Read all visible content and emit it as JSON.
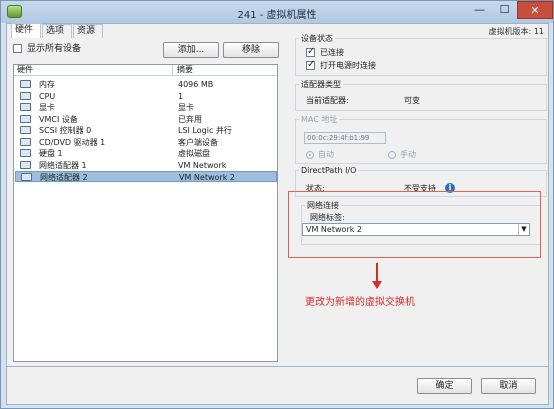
{
  "window": {
    "title": "241 - 虚拟机属性",
    "minimize_label": "—",
    "maximize_label": "☐",
    "close_label": "✕"
  },
  "tabs": [
    {
      "label": "硬件",
      "active": true
    },
    {
      "label": "选项",
      "active": false
    },
    {
      "label": "资源",
      "active": false
    }
  ],
  "version_text": "虚拟机版本: 11",
  "left_panel": {
    "show_all_label": "显示所有设备",
    "show_all_checked": false,
    "add_button": "添加...",
    "remove_button": "移除",
    "col_hardware": "硬件",
    "col_summary": "摘要",
    "devices": [
      {
        "icon": "memory-icon",
        "name": "内存",
        "summary": "4096 MB",
        "selected": false
      },
      {
        "icon": "cpu-icon",
        "name": "CPU",
        "summary": "1",
        "selected": false
      },
      {
        "icon": "display-icon",
        "name": "显卡",
        "summary": "显卡",
        "selected": false
      },
      {
        "icon": "vmci-icon",
        "name": "VMCI 设备",
        "summary": "已弃用",
        "selected": false
      },
      {
        "icon": "scsi-icon",
        "name": "SCSI 控制器 0",
        "summary": "LSI Logic 并行",
        "selected": false
      },
      {
        "icon": "cd-dvd-icon",
        "name": "CD/DVD 驱动器 1",
        "summary": "客户端设备",
        "selected": false
      },
      {
        "icon": "disk-icon",
        "name": "硬盘 1",
        "summary": "虚拟磁盘",
        "selected": false
      },
      {
        "icon": "network-icon",
        "name": "网络适配器 1",
        "summary": "VM Network",
        "selected": false
      },
      {
        "icon": "network-icon",
        "name": "网络适配器 2",
        "summary": "VM Network 2",
        "selected": true
      }
    ]
  },
  "device_status": {
    "title": "设备状态",
    "connected_label": "已连接",
    "connected_checked": true,
    "connect_at_power_on_label": "打开电源时连接",
    "connect_at_power_on_checked": true
  },
  "adapter_type": {
    "title": "适配器类型",
    "current_label": "当前适配器:",
    "current_value": "可变"
  },
  "mac_address": {
    "title": "MAC 地址",
    "value": "00:0c:29:4f:b1:99",
    "auto_label": "自动",
    "auto_selected": true,
    "manual_label": "手动",
    "manual_selected": false
  },
  "directpath": {
    "title": "DirectPath I/O",
    "status_label": "状态:",
    "status_value": "不受支持"
  },
  "network_connection": {
    "title": "网络连接",
    "label_text": "网络标签:",
    "selected_network": "VM Network 2"
  },
  "annotation_text": "更改为新增的虚拟交换机",
  "footer": {
    "ok_button": "确定",
    "cancel_button": "取消"
  },
  "colors": {
    "annotation": "#d62c28",
    "selection": "#9dbfdd",
    "info_icon": "#2a6fc4"
  }
}
